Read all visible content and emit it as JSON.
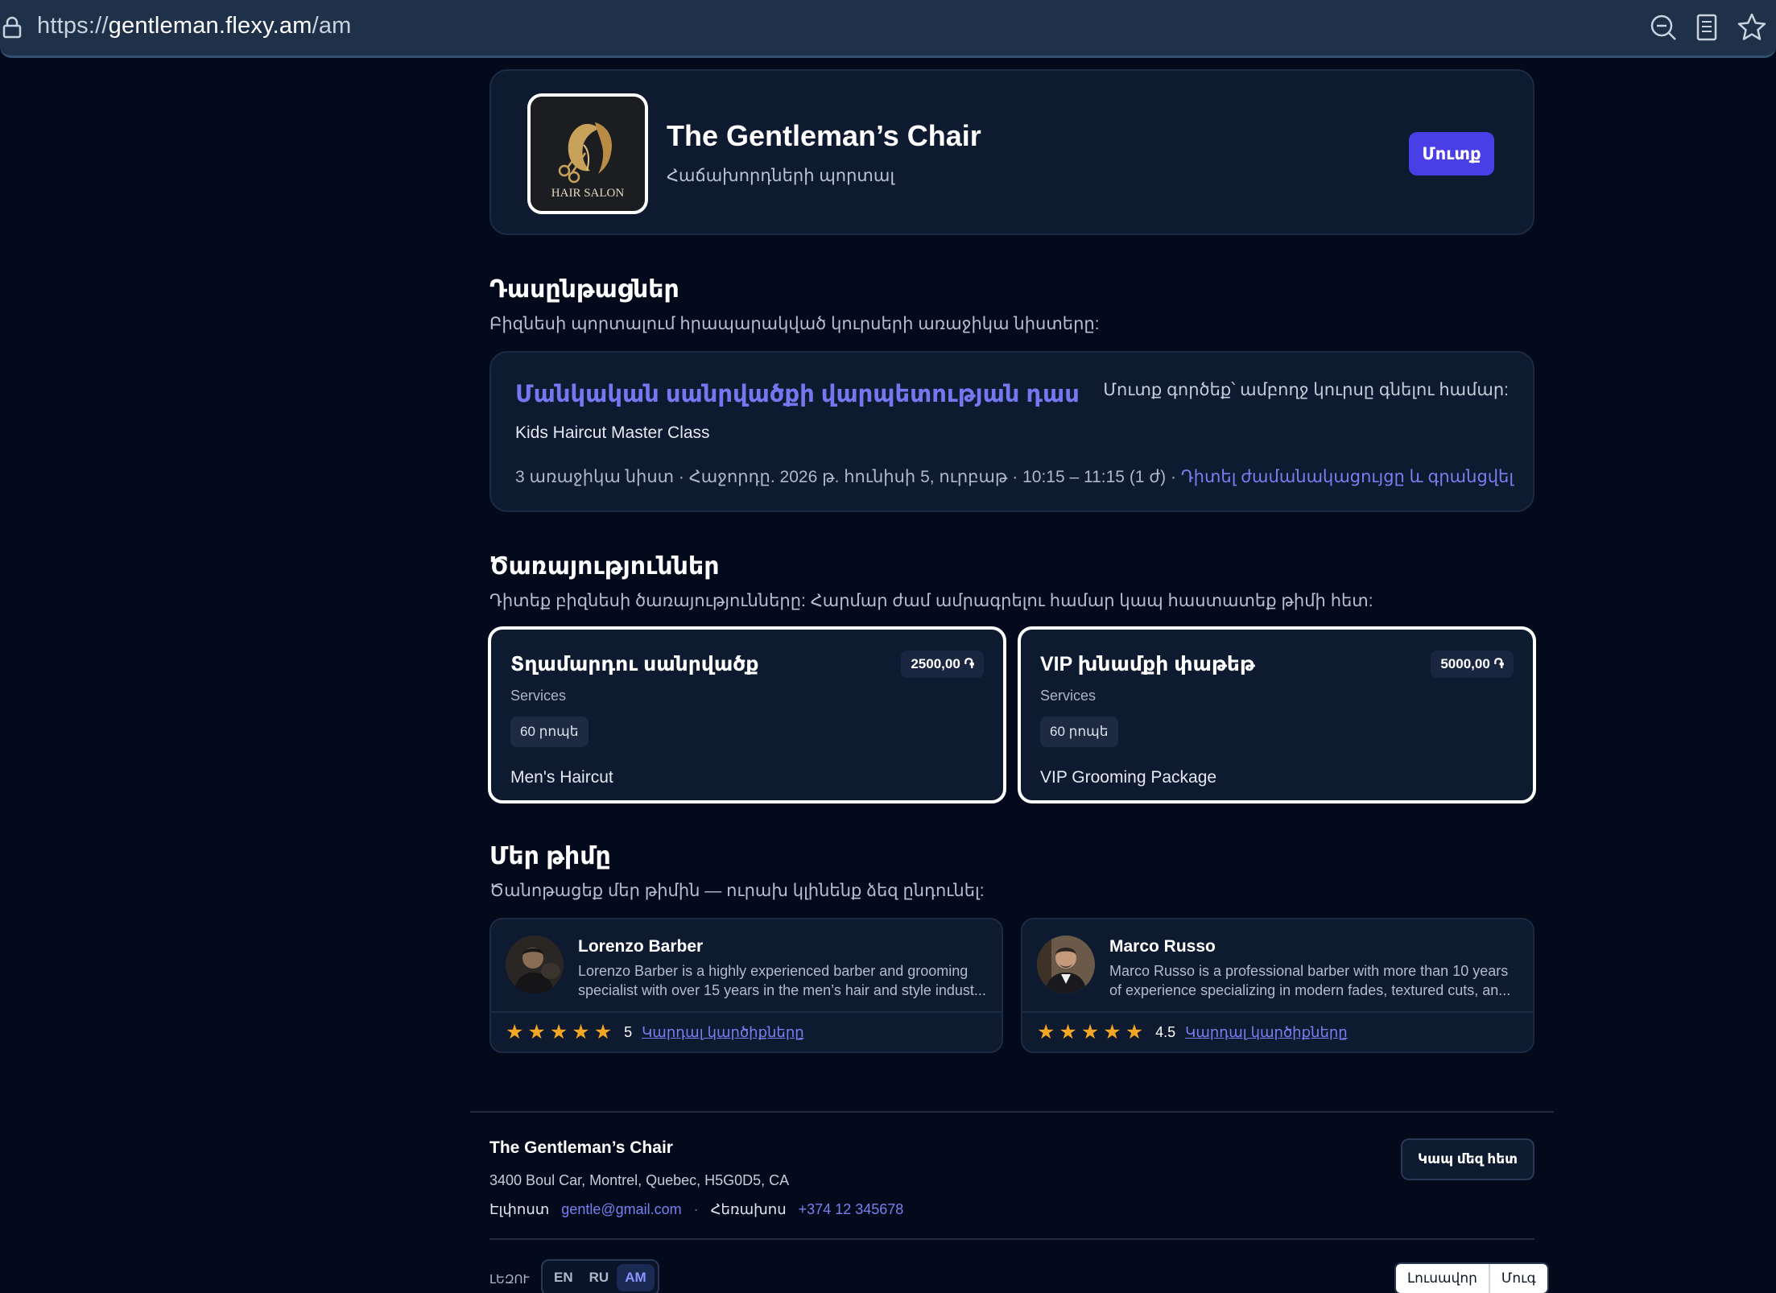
{
  "browser": {
    "url_scheme": "https://",
    "url_host": "gentleman.flexy.am",
    "url_path": "/am"
  },
  "business": {
    "name": "The Gentleman’s Chair",
    "subtitle": "Հաճախորդների պորտալ",
    "login_label": "Մուտք",
    "logo_text": "HAIR SALON"
  },
  "courses": {
    "title": "Դասընթացներ",
    "subtitle": "Բիզնեսի պորտալում հրապարակված կուրսերի առաջիկա նիստերը:",
    "items": [
      {
        "title": "Մանկական սանրվածքի վարպետության դաս",
        "login_note": "Մուտք գործեք՝ ամբողջ կուրսը գնելու համար:",
        "english_title": "Kids Haircut Master Class",
        "meta": "3 առաջիկա նիստ · Հաջորդը. 2026 թ. հունիսի 5, ուրբաթ · 10:15 – 11:15 (1 ժ) ·",
        "schedule_link": "Դիտել ժամանակացույցը և գրանցվել"
      }
    ]
  },
  "services": {
    "title": "Ծառայություններ",
    "subtitle": "Դիտեք բիզնեսի ծառայությունները: Հարմար ժամ ամրագրելու համար կապ հաստատեք թիմի հետ:",
    "items": [
      {
        "title": "Տղամարդու սանրվածք",
        "category": "Services",
        "price": "2500,00 ֏",
        "duration": "60 րոպե",
        "english_title": "Men's Haircut"
      },
      {
        "title": "VIP խնամքի փաթեթ",
        "category": "Services",
        "price": "5000,00 ֏",
        "duration": "60 րոպե",
        "english_title": "VIP Grooming Package"
      }
    ]
  },
  "team": {
    "title": "Մեր թիմը",
    "subtitle": "Ծանոթացեք մեր թիմին — ուրախ կլինենք ձեզ ընդունել:",
    "members": [
      {
        "name": "Lorenzo Barber",
        "bio_line1": "Lorenzo Barber is a highly experienced barber and grooming",
        "bio_line2": "specialist with over 15 years in the men’s hair and style indust...",
        "rating": "5",
        "rating_value": 5,
        "reviews_link": "Կարդալ կարծիքները"
      },
      {
        "name": "Marco Russo",
        "bio_line1": "Marco Russo is a professional barber with more than 10 years",
        "bio_line2": "of experience specializing in modern fades, textured cuts, an...",
        "rating": "4.5",
        "rating_value": 4.5,
        "reviews_link": "Կարդալ կարծիքները"
      }
    ]
  },
  "footer": {
    "name": "The Gentleman’s Chair",
    "address": "3400 Boul Car, Montrel, Quebec, H5G0D5, CA",
    "email_label": "Էլփոստ",
    "email": "gentle@gmail.com",
    "phone_label": "Հեռախոս",
    "phone": "+374 12 345678",
    "contact_button": "Կապ մեզ հետ",
    "language_label": "ԼԵԶՈՒ",
    "languages": [
      "EN",
      "RU",
      "AM"
    ],
    "active_language": "AM",
    "theme_light": "Լուսավոր",
    "theme_dark": "Մուգ"
  },
  "colors": {
    "background": "#030a1c",
    "card": "#0e1a30",
    "accent": "#4a3fe6",
    "link": "#7a7ff0",
    "star": "#f5a623"
  }
}
